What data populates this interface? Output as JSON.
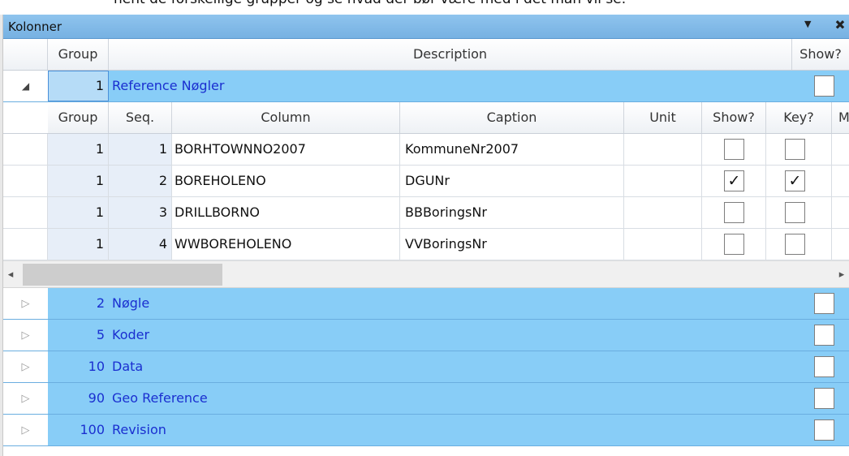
{
  "top_text": "hent de forskellige grupper og se hvad der bør være med i det man vil se.",
  "panel": {
    "title": "Kolonner",
    "dropdown_icon": "caret-down-icon",
    "pin_icon": "pin-icon"
  },
  "outer_headers": {
    "group": "Group",
    "description": "Description",
    "show": "Show?"
  },
  "expanded_group": {
    "group": "1",
    "description": "Reference Nøgler",
    "show": false,
    "expander": "◢"
  },
  "inner_headers": {
    "group": "Group",
    "seq": "Seq.",
    "column": "Column",
    "caption": "Caption",
    "unit": "Unit",
    "show": "Show?",
    "key": "Key?",
    "more": "M"
  },
  "inner_rows": [
    {
      "group": "1",
      "seq": "1",
      "column": "BORHTOWNNO2007",
      "caption": "KommuneNr2007",
      "unit": "",
      "show": false,
      "key": false
    },
    {
      "group": "1",
      "seq": "2",
      "column": "BOREHOLENO",
      "caption": "DGUNr",
      "unit": "",
      "show": true,
      "key": true
    },
    {
      "group": "1",
      "seq": "3",
      "column": "DRILLBORNO",
      "caption": "BBBoringsNr",
      "unit": "",
      "show": false,
      "key": false
    },
    {
      "group": "1",
      "seq": "4",
      "column": "WWBOREHOLENO",
      "caption": "VVBoringsNr",
      "unit": "",
      "show": false,
      "key": false
    }
  ],
  "scrollbar": {
    "left_arrow": "◂",
    "right_arrow": "▸"
  },
  "collapsed_groups": [
    {
      "group": "2",
      "description": "Nøgle",
      "show": false,
      "expander": "▷"
    },
    {
      "group": "5",
      "description": "Koder",
      "show": false,
      "expander": "▷"
    },
    {
      "group": "10",
      "description": "Data",
      "show": false,
      "expander": "▷"
    },
    {
      "group": "90",
      "description": "Geo Reference",
      "show": false,
      "expander": "▷"
    },
    {
      "group": "100",
      "description": "Revision",
      "show": false,
      "expander": "▷"
    }
  ],
  "checkmark": "✓"
}
